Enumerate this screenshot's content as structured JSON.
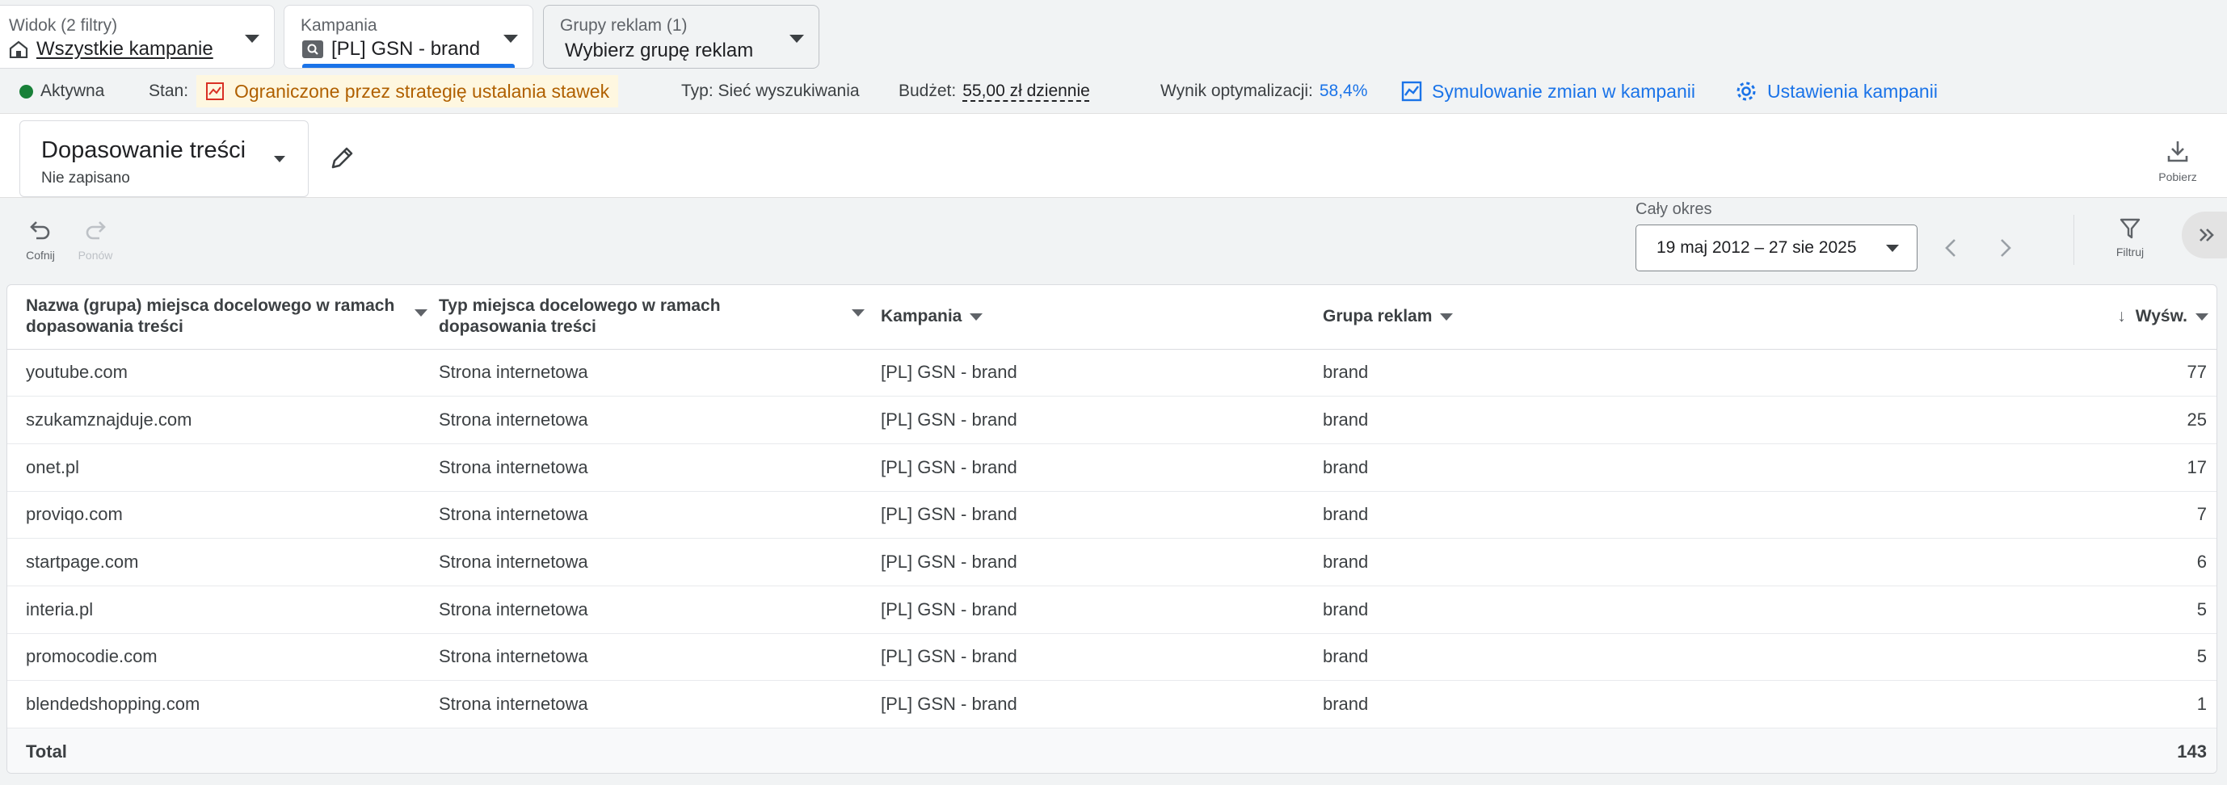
{
  "selectors": {
    "view": {
      "label": "Widok (2 filtry)",
      "value": "Wszystkie kampanie"
    },
    "campaign": {
      "label": "Kampania",
      "value": "[PL] GSN - brand"
    },
    "ad_groups": {
      "label": "Grupy reklam (1)",
      "value": "Wybierz grupę reklam"
    }
  },
  "status_bar": {
    "active": "Aktywna",
    "state_label": "Stan:",
    "state_value": "Ograniczone przez strategię ustalania stawek",
    "type": "Typ: Sieć wyszukiwania",
    "budget_label": "Budżet:",
    "budget_value": "55,00 zł dziennie",
    "score_label": "Wynik optymalizacji:",
    "score_value": "58,4%",
    "simulate_link": "Symulowanie zmian w kampanii",
    "settings_link": "Ustawienia kampanii",
    "colors": {
      "active": "#188038",
      "warning": "#b06000",
      "link": "#1a73e8"
    }
  },
  "report": {
    "title": "Dopasowanie treści",
    "subtitle": "Nie zapisano",
    "download_label": "Pobierz"
  },
  "toolbar": {
    "undo_label": "Cofnij",
    "redo_label": "Ponów",
    "range_label": "Cały okres",
    "range_value": "19 maj 2012 – 27 sie 2025",
    "filter_label": "Filtruj"
  },
  "table": {
    "columns": [
      "Nazwa (grupa) miejsca docelowego w ramach dopasowania treści",
      "Typ miejsca docelowego w ramach dopasowania treści",
      "Kampania",
      "Grupa reklam",
      "Wyśw."
    ],
    "rows": [
      [
        "youtube.com",
        "Strona internetowa",
        "[PL] GSN - brand",
        "brand",
        "77"
      ],
      [
        "szukamznajduje.com",
        "Strona internetowa",
        "[PL] GSN - brand",
        "brand",
        "25"
      ],
      [
        "onet.pl",
        "Strona internetowa",
        "[PL] GSN - brand",
        "brand",
        "17"
      ],
      [
        "proviqo.com",
        "Strona internetowa",
        "[PL] GSN - brand",
        "brand",
        "7"
      ],
      [
        "startpage.com",
        "Strona internetowa",
        "[PL] GSN - brand",
        "brand",
        "6"
      ],
      [
        "interia.pl",
        "Strona internetowa",
        "[PL] GSN - brand",
        "brand",
        "5"
      ],
      [
        "promocodie.com",
        "Strona internetowa",
        "[PL] GSN - brand",
        "brand",
        "5"
      ],
      [
        "blendedshopping.com",
        "Strona internetowa",
        "[PL] GSN - brand",
        "brand",
        "1"
      ]
    ],
    "total_label": "Total",
    "total_value": "143"
  }
}
